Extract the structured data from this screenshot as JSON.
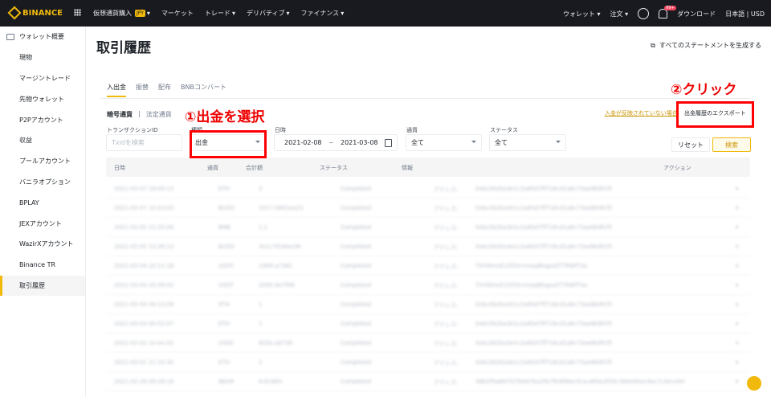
{
  "topbar": {
    "brand": "BINANCE",
    "nav": [
      {
        "label": "仮想通貨購入",
        "badge": "JPY"
      },
      {
        "label": "マーケット"
      },
      {
        "label": "トレード"
      },
      {
        "label": "デリバティブ"
      },
      {
        "label": "ファイナンス"
      }
    ],
    "wallet": "ウォレット",
    "orders": "注文",
    "notif": "99+",
    "download": "ダウンロード",
    "lang": "日本語",
    "divider": "|",
    "currency": "USD"
  },
  "sidebar": {
    "items": [
      "ウォレット概要",
      "現物",
      "マージントレード",
      "先物ウォレット",
      "P2Pアカウント",
      "収益",
      "プールアカウント",
      "バニラオプション",
      "BPLAY",
      "JEXアカウント",
      "WazirXアカウント",
      "Binance TR",
      "取引履歴"
    ],
    "active_index": 12
  },
  "page": {
    "title": "取引履歴",
    "generate": "すべてのステートメントを生成する"
  },
  "tabs": [
    "入出金",
    "振替",
    "配布",
    "BNBコンバート"
  ],
  "subtabs": [
    "暗号通貨",
    "法定通貨"
  ],
  "filters": {
    "tx_label": "トランザクションID",
    "tx_placeholder": "Txidを検索",
    "type_label": "種類",
    "type_value": "出金",
    "date_label": "日時",
    "date_from": "2021-02-08",
    "date_sep": "~",
    "date_to": "2021-03-08",
    "coin_label": "通貨",
    "coin_value": "全て",
    "status_label": "ステータス",
    "status_value": "全て",
    "reset": "リセット",
    "search": "検索"
  },
  "links": {
    "not_reflected": "入金が反映されていない場合",
    "export": "出金履歴のエクスポート"
  },
  "annotations": {
    "step1": "①出金を選択",
    "step2": "②クリック"
  },
  "table": {
    "headers": [
      "日時",
      "通貨",
      "合計額",
      "ステータス",
      "情報",
      "アクション"
    ],
    "rows": [
      [
        "2021-03-07 18:00:13",
        "ETH",
        "3",
        "Completed",
        "アドレス:",
        "0xbc0b2ba3e1c2a85d7ff718cd1a8c73ae8b9fcf5"
      ],
      [
        "2021-03-07 10:23:03",
        "BUSD",
        "1017.0901ea23",
        "Completed",
        "アドレス:",
        "0xbc0b2ba3e1c2a85d7ff718cd1a8c73ae8b9fcf5"
      ],
      [
        "2021-03-05 21:25:06",
        "BNB",
        "1.1",
        "Completed",
        "アドレス:",
        "0xbc0b2ba3e1c2a85d7ff718cd1a8c73ae8b9fcf5"
      ],
      [
        "2021-03-05 10:39:13",
        "BUSD",
        "3e1c7916ae38",
        "Completed",
        "アドレス:",
        "0xbc0b2ba3e1c2a85d7ff718cd1a8c73ae8b9fcf5"
      ],
      [
        "2021-03-04 22:11:18",
        "USDT",
        "1999.a7381",
        "Completed",
        "アドレス:",
        "TXrfdmnE12f3Srvmsq8Kqpa5T7RWfT3a"
      ],
      [
        "2021-03-04 20:39:02",
        "USDT",
        "2095.9e7f06",
        "Completed",
        "アドレス:",
        "TXrfdmnE12f3Srvmsq8Kqpa5T7RWfT3a"
      ],
      [
        "2021-03-04 09:13:09",
        "ETH",
        "1",
        "Completed",
        "アドレス:",
        "0xbc0b2ba3e1c2a85d7ff718cd1a8c73ae8b9fcf5"
      ],
      [
        "2021-03-03 00:52:07",
        "ETH",
        "1",
        "Completed",
        "アドレス:",
        "0xbc0b2ba3e1c2a85d7ff718cd1a8c73ae8b9fcf5"
      ],
      [
        "2021-03-02 1e:ee:20",
        "USDC",
        "603e.a9739",
        "Completed",
        "アドレス:",
        "0xbc0b2ba3e1c2a85d7ff718cd1a8c73ae8b9fcf5"
      ],
      [
        "2021-03-01 21:10:30",
        "ETH",
        "1",
        "Completed",
        "アドレス:",
        "0xbc0b2ba3e1c2a85d7ff718cd1a8c73ae8b9fcf5"
      ],
      [
        "2021-02-28 09:28:16",
        "NEAR",
        "6.61983",
        "Completed",
        "アドレス:",
        "38b2f9a687f27b0d7ba2fb7fb9f9becfcacd83e3f35c3b0e95ac9ac7c3ece4d"
      ]
    ]
  }
}
